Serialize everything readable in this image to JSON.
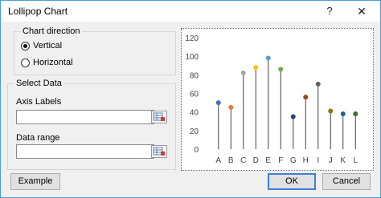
{
  "window": {
    "title": "Lollipop Chart",
    "help_label": "?",
    "close_label": "✕"
  },
  "direction": {
    "group_label": "Chart direction",
    "options": [
      {
        "label": "Vertical",
        "selected": true
      },
      {
        "label": "Horizontal",
        "selected": false
      }
    ]
  },
  "select_data": {
    "group_label": "Select Data",
    "axis_labels": {
      "label": "Axis Labels",
      "value": ""
    },
    "data_range": {
      "label": "Data range",
      "value": ""
    }
  },
  "buttons": {
    "example": "Example",
    "ok": "OK",
    "cancel": "Cancel"
  },
  "chart_data": {
    "type": "lollipop",
    "categories": [
      "A",
      "B",
      "C",
      "D",
      "E",
      "F",
      "G",
      "H",
      "I",
      "J",
      "K",
      "L"
    ],
    "values": [
      50,
      45,
      82,
      88,
      98,
      86,
      35,
      56,
      70,
      41,
      38,
      38
    ],
    "colors": [
      "#4472c4",
      "#ed7d31",
      "#a5a5a5",
      "#ffc000",
      "#5b9bd5",
      "#70ad47",
      "#264478",
      "#9e480e",
      "#636363",
      "#997300",
      "#255e91",
      "#43682b"
    ],
    "stem_color": "#404040",
    "yticks": [
      0,
      20,
      40,
      60,
      80,
      100,
      120
    ],
    "ylim": [
      0,
      120
    ],
    "grid": false
  }
}
